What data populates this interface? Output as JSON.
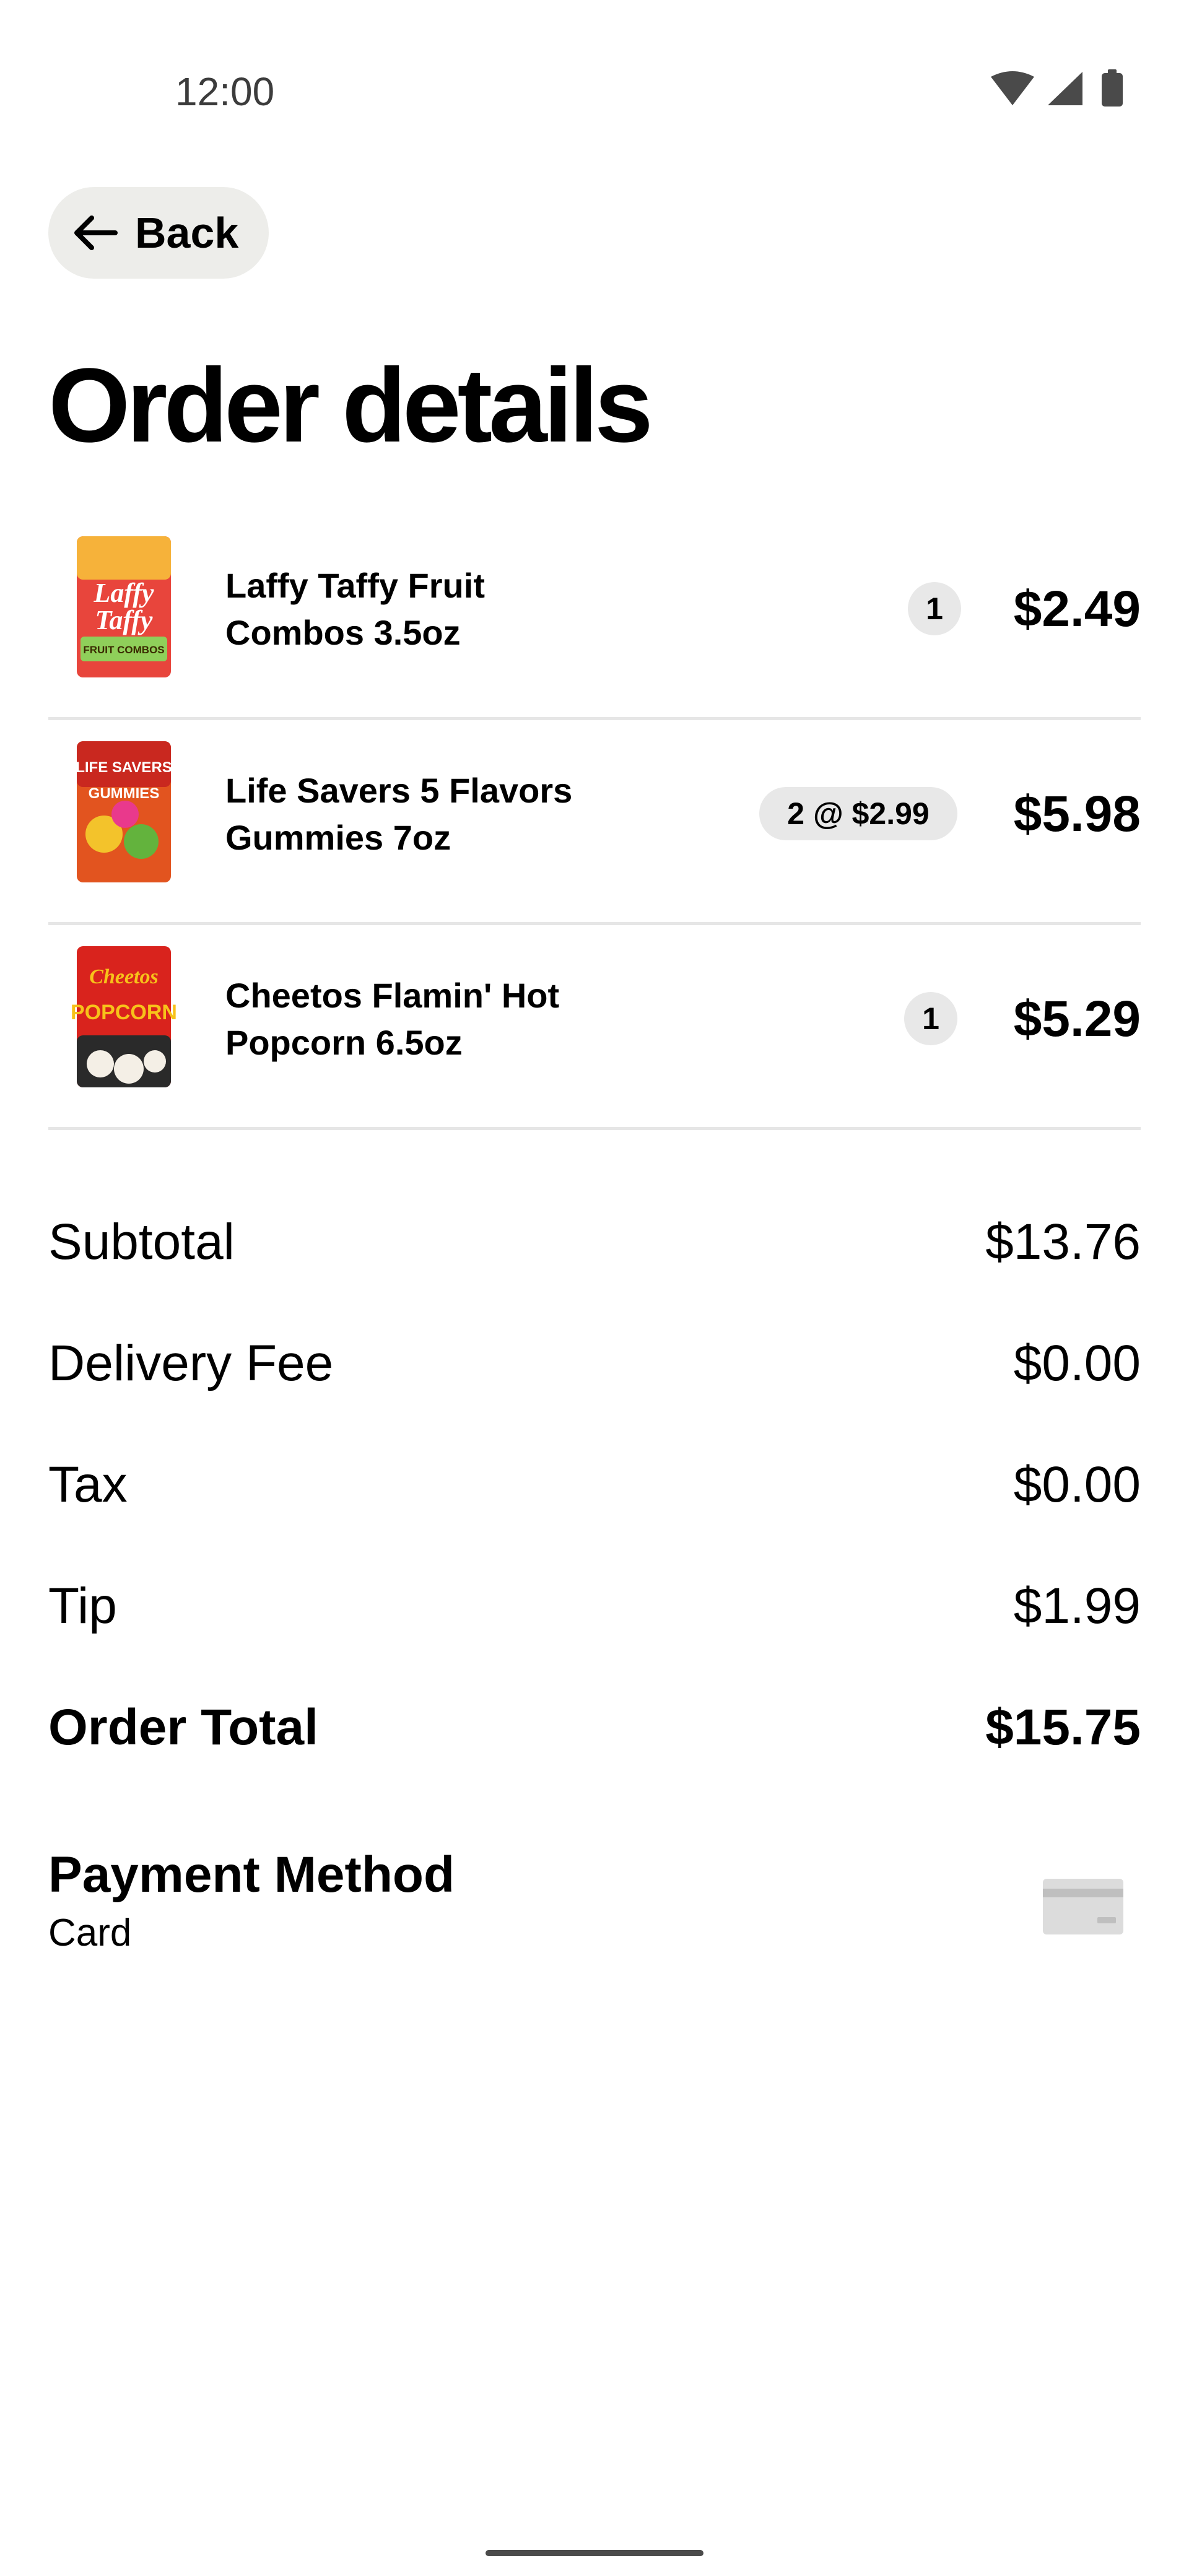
{
  "status_bar": {
    "time": "12:00",
    "icons": [
      "wifi-icon",
      "cellular-signal-icon",
      "battery-icon"
    ]
  },
  "header": {
    "back_label": "Back",
    "title": "Order details"
  },
  "items": [
    {
      "name_line1": "Laffy Taffy Fruit",
      "name_line2": "Combos 3.5oz",
      "quantity": "1",
      "price": "$2.49",
      "thumb_label1": "Laffy",
      "thumb_label2": "Taffy",
      "thumb_label3": "FRUIT COMBOS",
      "thumb_color": "#e8453c"
    },
    {
      "name_line1": "Life Savers 5 Flavors",
      "name_line2": "Gummies 7oz",
      "quantity": "2 @ $2.99",
      "price": "$5.98",
      "thumb_label1": "LIFE SAVERS",
      "thumb_label2": "GUMMIES",
      "thumb_color": "#e2541f"
    },
    {
      "name_line1": "Cheetos Flamin' Hot",
      "name_line2": "Popcorn 6.5oz",
      "quantity": "1",
      "price": "$5.29",
      "thumb_label1": "Cheetos",
      "thumb_label2": "POPCORN",
      "thumb_color": "#d9231d"
    }
  ],
  "summary": {
    "subtotal_label": "Subtotal",
    "subtotal_value": "$13.76",
    "delivery_label": "Delivery Fee",
    "delivery_value": "$0.00",
    "tax_label": "Tax",
    "tax_value": "$0.00",
    "tip_label": "Tip",
    "tip_value": "$1.99",
    "total_label": "Order Total",
    "total_value": "$15.75"
  },
  "payment": {
    "title": "Payment Method",
    "method": "Card",
    "icon": "credit-card-icon"
  },
  "colors": {
    "back_button_bg": "#ededea",
    "pill_bg": "#e8e8e8",
    "divider": "#e6e6e6",
    "card_icon": "#dcdcdc"
  }
}
